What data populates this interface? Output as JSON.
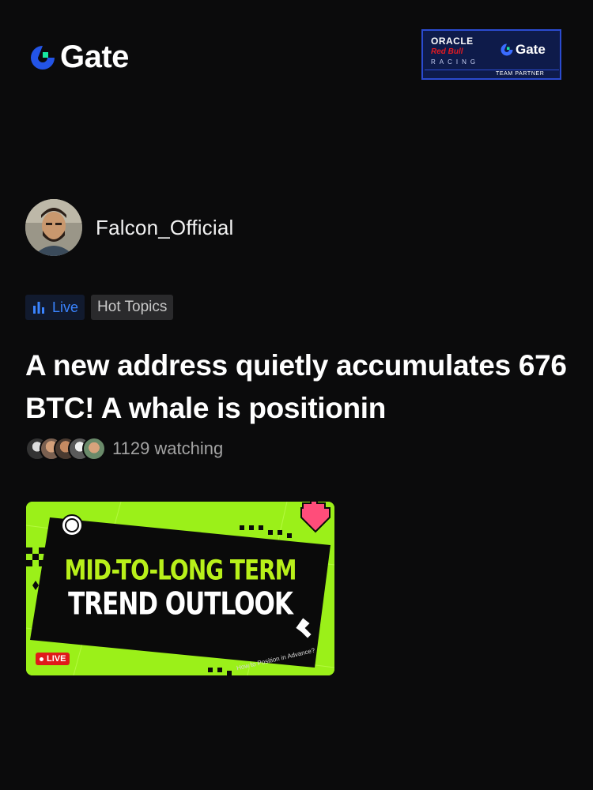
{
  "header": {
    "brand": "Gate",
    "partner": {
      "oracle": "ORACLE",
      "redbull": "Red Bull",
      "racing": "RACING",
      "brand": "Gate",
      "team_partner": "TEAM PARTNER"
    }
  },
  "post": {
    "author": "Falcon_Official",
    "tags": {
      "live": "Live",
      "topic": "Hot Topics"
    },
    "title": "A new address quietly accumulates 676 BTC! A whale is positionin",
    "watching": "1129 watching"
  },
  "thumbnail": {
    "line1": "MID-TO-LONG TERM",
    "line2": "TREND OUTLOOK",
    "subtitle": "How to Position in Advance?",
    "badge": "LIVE"
  },
  "colors": {
    "background": "#0b0b0c",
    "brand_blue": "#2354e6",
    "brand_green": "#17e8a0",
    "live_blue": "#3a84ff",
    "thumb_green": "#9bf019",
    "live_red": "#e01a1a"
  }
}
